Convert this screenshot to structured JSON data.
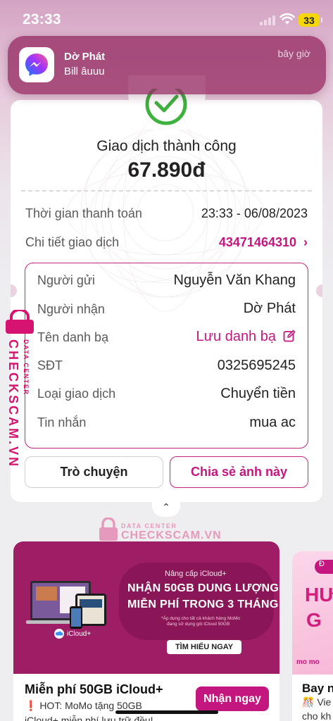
{
  "status_bar": {
    "time": "23:33",
    "battery": "33",
    "battery_color": "#f5d60a"
  },
  "notification": {
    "title": "Dờ Phát",
    "body": "Bill âuuu",
    "time": "bây giờ",
    "icon": "messenger-icon"
  },
  "receipt": {
    "status": "Giao dịch thành công",
    "amount": "67.890đ",
    "status_icon": "check-circle-icon",
    "payment_time_label": "Thời gian thanh toán",
    "payment_time_value": "23:33 - 06/08/2023",
    "transaction_label": "Chi tiết giao dịch",
    "transaction_id": "43471464310",
    "details": [
      {
        "label": "Người gửi",
        "value": "Nguyễn Văn Khang"
      },
      {
        "label": "Người nhận",
        "value": "Dờ Phát"
      },
      {
        "label": "Tên danh bạ",
        "value": "Lưu danh bạ"
      },
      {
        "label": "SĐT",
        "value": "0325695245"
      },
      {
        "label": "Loại giao dịch",
        "value": "Chuyển tiền"
      },
      {
        "label": "Tin nhắn",
        "value": "mua ac"
      }
    ],
    "chat_button": "Trò chuyện",
    "share_button": "Chia sẻ ảnh này",
    "accent_color": "#c4167f",
    "success_color": "#3fb13f"
  },
  "watermark": {
    "brand": "CHECKSCAM.VN",
    "sub": "DATA CENTER"
  },
  "promo": {
    "banner_small": "Nâng cấp iCloud+",
    "banner_line1": "NHẬN 50GB DUNG LƯỢNG",
    "banner_line2": "MIỄN PHÍ TRONG 3 THÁNG",
    "banner_note1": "*Áp dụng cho tất cả khách hàng MoMo",
    "banner_note2": "đang sử dụng gói iCloud 50GB",
    "banner_cta": "TÌM HIỂU NGAY",
    "icloud_tag": "iCloud+",
    "title": "Miễn phí 50GB iCloud+",
    "sub1": "❗ HOT: MoMo tặng 50GB",
    "sub2": "iCloud+ miễn phí lưu trữ đều!",
    "button": "Nhận ngay"
  },
  "promo2": {
    "pill": "Đ",
    "big1": "HƯ",
    "big2": "G",
    "logo": "mo mo",
    "title": "Bay n",
    "sub1": "🎊 Vie",
    "sub2": "cho kh"
  }
}
